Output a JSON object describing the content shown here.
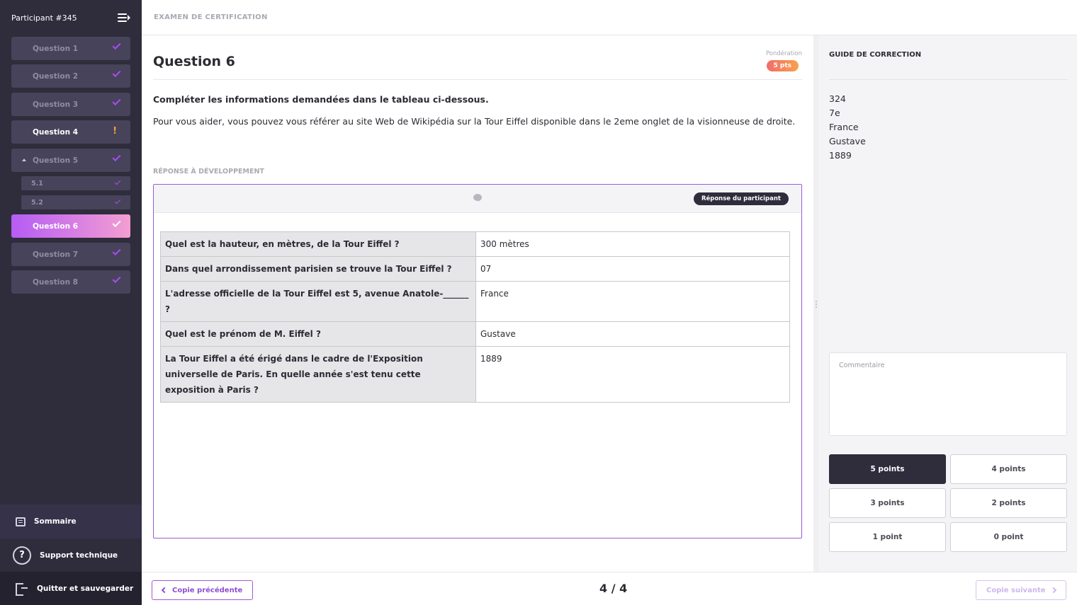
{
  "sidebar": {
    "participant": "Participant #345",
    "questions": [
      {
        "label": "Question 1",
        "status": "check"
      },
      {
        "label": "Question 2",
        "status": "check"
      },
      {
        "label": "Question 3",
        "status": "check"
      },
      {
        "label": "Question 4",
        "status": "warning"
      },
      {
        "label": "Question 5",
        "status": "check",
        "expanded": true
      },
      {
        "label": "Question 6",
        "status": "check",
        "active": true
      },
      {
        "label": "Question 7",
        "status": "check"
      },
      {
        "label": "Question 8",
        "status": "check"
      }
    ],
    "subitems": [
      {
        "label": "5.1",
        "status": "check"
      },
      {
        "label": "5.2",
        "status": "check"
      }
    ],
    "warning_symbol": "!",
    "summary_label": "Sommaire",
    "support_label": "Support technique",
    "help_symbol": "?",
    "quit_label": "Quitter et sauvegarder"
  },
  "topbar": {
    "title": "EXAMEN DE CERTIFICATION"
  },
  "question": {
    "title": "Question 6",
    "weight_label": "Pondération",
    "weight_value": "5 pts",
    "instruction_main": "Compléter les informations demandées dans le tableau ci-dessous.",
    "instruction_help": "Pour vous aider, vous pouvez vous référer au site Web de Wikipédia sur la Tour Eiffel disponible dans le 2eme onglet de la visionneuse de droite.",
    "response_label": "RÉPONSE À DÉVELOPPEMENT",
    "participant_badge": "Réponse du participant",
    "table": [
      {
        "q": "Quel est la hauteur, en mètres, de la Tour Eiffel ?",
        "a": "300 mètres"
      },
      {
        "q": "Dans quel arrondissement parisien se trouve la Tour Eiffel ?",
        "a": "07"
      },
      {
        "q": "L'adresse officielle de la Tour Eiffel est 5, avenue Anatole-______ ?",
        "a": "France"
      },
      {
        "q": "Quel est le prénom de M. Eiffel ?",
        "a": "Gustave"
      },
      {
        "q": "La Tour Eiffel a été érigé dans le cadre de l'Exposition universelle de Paris. En quelle année s'est tenu cette exposition à Paris ?",
        "a": "1889"
      }
    ]
  },
  "guide": {
    "title": "GUIDE DE CORRECTION",
    "answers": [
      "324",
      "7e",
      "France",
      "Gustave",
      "1889"
    ],
    "comment_placeholder": "Commentaire",
    "points": [
      "5 points",
      "4 points",
      "3 points",
      "2 points",
      "1 point",
      "0 point"
    ],
    "selected_points": "5 points"
  },
  "bottom": {
    "prev_label": "Copie précédente",
    "next_label": "Copie suivante",
    "counter": "4 / 4"
  },
  "colors": {
    "sidebar_bg": "#2f2c3c",
    "accent_purple": "#9b5bd6",
    "active_gradient_start": "#b55cf5",
    "active_gradient_end": "#f49ed2",
    "warning": "#f0a23a"
  }
}
